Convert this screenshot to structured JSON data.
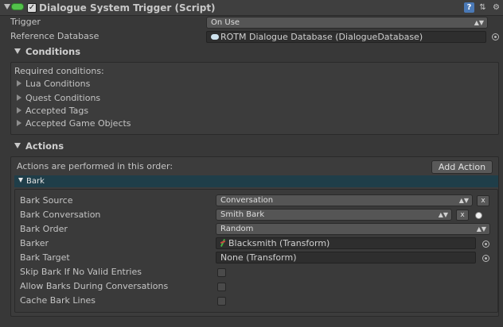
{
  "component": {
    "title": "Dialogue System Trigger (Script)",
    "enabled_mark": "✓",
    "help_icon": "?"
  },
  "fields": {
    "trigger_label": "Trigger",
    "trigger_value": "On Use",
    "refdb_label": "Reference Database",
    "refdb_value": "ROTM Dialogue Database (DialogueDatabase)"
  },
  "conditions": {
    "header": "Conditions",
    "required_label": "Required conditions:",
    "items": [
      "Lua Conditions",
      "Quest Conditions",
      "Accepted Tags",
      "Accepted Game Objects"
    ]
  },
  "actions": {
    "header": "Actions",
    "order_text": "Actions are performed in this order:",
    "add_button": "Add Action",
    "bark_header": "Bark",
    "bark": {
      "source_label": "Bark Source",
      "source_value": "Conversation",
      "conversation_label": "Bark Conversation",
      "conversation_value": "Smith Bark",
      "order_label": "Bark Order",
      "order_value": "Random",
      "barker_label": "Barker",
      "barker_value": "Blacksmith (Transform)",
      "target_label": "Bark Target",
      "target_value": "None (Transform)",
      "skip_label": "Skip Bark If No Valid Entries",
      "allow_label": "Allow Barks During Conversations",
      "cache_label": "Cache Bark Lines",
      "x_label": "x"
    }
  },
  "colors": {
    "accent_bar": "#1f3e49",
    "component_icon": "#53c14b",
    "help_icon": "#4a79b6"
  },
  "icons": [
    "component-toggle-icon",
    "help-icon",
    "preset-icon",
    "gear-icon",
    "object-picker-icon",
    "database-icon",
    "transform-icon"
  ]
}
